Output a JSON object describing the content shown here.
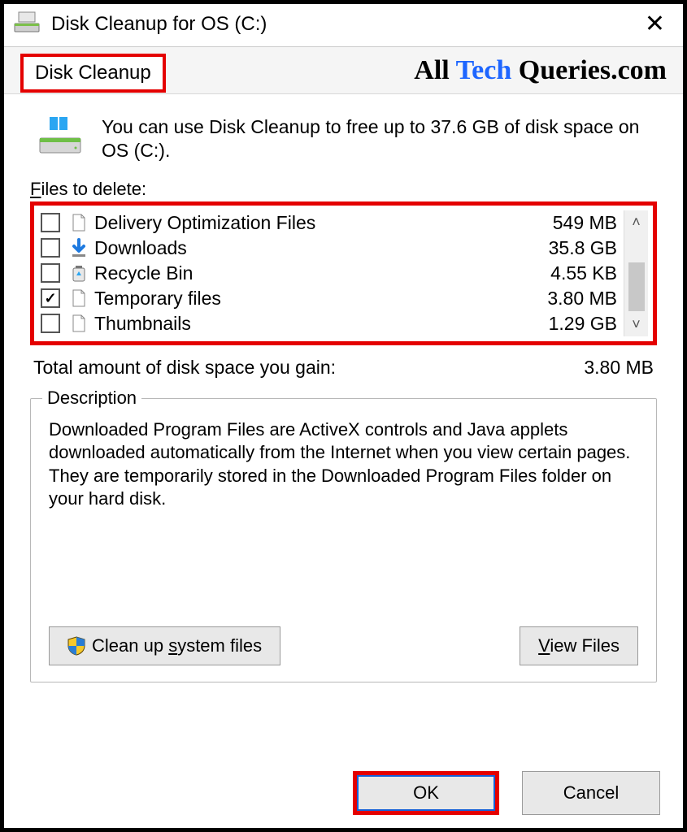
{
  "window": {
    "title": "Disk Cleanup for OS (C:)"
  },
  "tab": {
    "label": "Disk Cleanup"
  },
  "watermark": {
    "part1": "All ",
    "part2": "Tech",
    "part3": " Queries.com"
  },
  "intro": "You can use Disk Cleanup to free up to 37.6 GB of disk space on OS (C:).",
  "files_label_pre": "F",
  "files_label_rest": "iles to delete:",
  "items": [
    {
      "name": "Delivery Optimization Files",
      "size": "549 MB",
      "checked": false,
      "icon": "page"
    },
    {
      "name": "Downloads",
      "size": "35.8 GB",
      "checked": false,
      "icon": "download"
    },
    {
      "name": "Recycle Bin",
      "size": "4.55 KB",
      "checked": false,
      "icon": "recycle"
    },
    {
      "name": "Temporary files",
      "size": "3.80 MB",
      "checked": true,
      "icon": "page"
    },
    {
      "name": "Thumbnails",
      "size": "1.29 GB",
      "checked": false,
      "icon": "page"
    }
  ],
  "total": {
    "label": "Total amount of disk space you gain:",
    "value": "3.80 MB"
  },
  "description": {
    "legend": "Description",
    "text": "Downloaded Program Files are ActiveX controls and Java applets downloaded automatically from the Internet when you view certain pages. They are temporarily stored in the Downloaded Program Files folder on your hard disk."
  },
  "buttons": {
    "cleanup_pre": "Clean up ",
    "cleanup_ul": "s",
    "cleanup_post": "ystem files",
    "view_ul": "V",
    "view_post": "iew Files",
    "ok": "OK",
    "cancel": "Cancel"
  }
}
